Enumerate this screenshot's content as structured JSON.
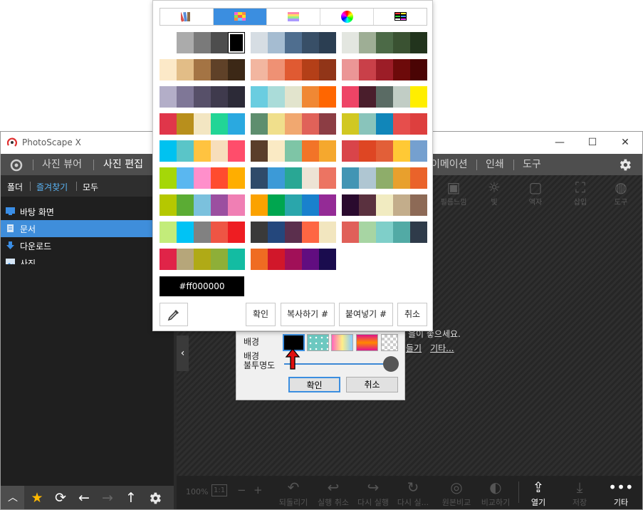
{
  "window": {
    "title": "PhotoScape X",
    "controls": [
      "—",
      "☐",
      "✕"
    ]
  },
  "menu": {
    "items": [
      "사진 뷰어",
      "사진 편집",
      "이메이션",
      "인쇄",
      "도구"
    ]
  },
  "left_panel": {
    "tabs": [
      "폴더",
      "즐겨찾기",
      "모두"
    ],
    "folders": [
      "바탕 화면",
      "문서",
      "다운로드",
      "사진"
    ]
  },
  "toolbar": {
    "items": [
      "필름느낌",
      "빛",
      "액자",
      "삽입",
      "도구"
    ]
  },
  "bottom_bar": {
    "zoom": "100%",
    "ratio": "1:1",
    "minus": "−",
    "plus": "+",
    "actions": [
      "되돌리기",
      "실행 취소",
      "다시 실행",
      "다시 실...",
      "원본비교",
      "비교하기",
      "열기",
      "저장",
      "기타"
    ]
  },
  "hints": {
    "line1": "을이 좋으세요.",
    "link1": "들기",
    "link2": "기타..."
  },
  "bg_dialog": {
    "bg_label": "배경",
    "opacity_label_1": "배경",
    "opacity_label_2": "불투명도",
    "ok": "확인",
    "cancel": "취소"
  },
  "picker": {
    "tabs": [
      "palette-icon",
      "swatch-grid-icon",
      "stripes-icon",
      "color-wheel-icon",
      "bars-icon"
    ],
    "hex": "#ff000000",
    "buttons": {
      "ok": "확인",
      "copy": "복사하기 #",
      "paste": "붙여넣기 #",
      "cancel": "취소"
    },
    "palettes": [
      [
        [
          "#ffffff",
          "#ababab",
          "#7a7a7a",
          "#4d4d4d",
          "#000000"
        ],
        [
          "#d6dde3",
          "#a5bcd1",
          "#4f6e8f",
          "#384f67",
          "#2b3e52"
        ],
        [
          "#e3e6e0",
          "#9eae95",
          "#4c6a47",
          "#3a5232",
          "#22341d"
        ]
      ],
      [
        [
          "#fce9c8",
          "#e2bd87",
          "#a47444",
          "#5f4128",
          "#3c2816"
        ],
        [
          "#f2b6a0",
          "#ef9174",
          "#e05a32",
          "#b43f18",
          "#913518"
        ],
        [
          "#eb9696",
          "#c94049",
          "#9c1d27",
          "#6d0a0a",
          "#4a0404"
        ]
      ],
      [
        [
          "#b3aec8",
          "#7f7797",
          "#575069",
          "#3f3a4d",
          "#2c2a37"
        ],
        [
          "#6acde0",
          "#aadcd9",
          "#e2e4cd",
          "#f08834",
          "#ff6600"
        ],
        [
          "#ee4466",
          "#4a1e2c",
          "#5a6b64",
          "#c1cdc5",
          "#ffee00"
        ]
      ],
      [
        [
          "#e0364a",
          "#b88f1c",
          "#f3e6c2",
          "#22d596",
          "#2aa9e0"
        ],
        [
          "#5e8e6e",
          "#f0df8c",
          "#f1a870",
          "#e06259",
          "#8c3d44"
        ],
        [
          "#d1c822",
          "#89c4bb",
          "#1186b9",
          "#e64e4c",
          "#dd3f3e"
        ]
      ],
      [
        [
          "#00c2f0",
          "#5ac5c8",
          "#ffc340",
          "#f7debb",
          "#ff4d6b"
        ],
        [
          "#5a3e2a",
          "#faeac4",
          "#7ec5a6",
          "#f27428",
          "#f5a82e"
        ],
        [
          "#d9444a",
          "#de4623",
          "#e25f38",
          "#ffc935",
          "#75a0cf"
        ]
      ],
      [
        [
          "#a5d708",
          "#5ab7f0",
          "#ff8fcb",
          "#ff4b2f",
          "#ffae00"
        ],
        [
          "#2f4b6a",
          "#3c9ad7",
          "#29a794",
          "#ede3d5",
          "#ec7462"
        ],
        [
          "#4295b4",
          "#afc6d2",
          "#8ead6a",
          "#e8a02d",
          "#ea632a"
        ]
      ],
      [
        [
          "#b5c800",
          "#5bac34",
          "#7bc1dd",
          "#9b4fa0",
          "#f07fb4"
        ],
        [
          "#fba200",
          "#00a64f",
          "#2aa6ab",
          "#1981cd",
          "#942b96"
        ],
        [
          "#2a0a2e",
          "#5a313f",
          "#f1ebc1",
          "#c3ad8b",
          "#8d6a56"
        ]
      ],
      [
        [
          "#c3ec7a",
          "#00c3f5",
          "#818181",
          "#ee5544",
          "#ee1d22"
        ],
        [
          "#3a3a3a",
          "#24477c",
          "#5b2f4d",
          "#fe6643",
          "#f2e6bf"
        ],
        [
          "#e06059",
          "#a7d5a3",
          "#7fcfc9",
          "#52aaa5",
          "#2f3b4a"
        ]
      ],
      [
        [
          "#e02448",
          "#b6a67a",
          "#b0aa16",
          "#8eaf38",
          "#13bca2"
        ],
        [
          "#ef6c22",
          "#d1172a",
          "#a11058",
          "#610d80",
          "#1a0c4e"
        ]
      ]
    ]
  }
}
